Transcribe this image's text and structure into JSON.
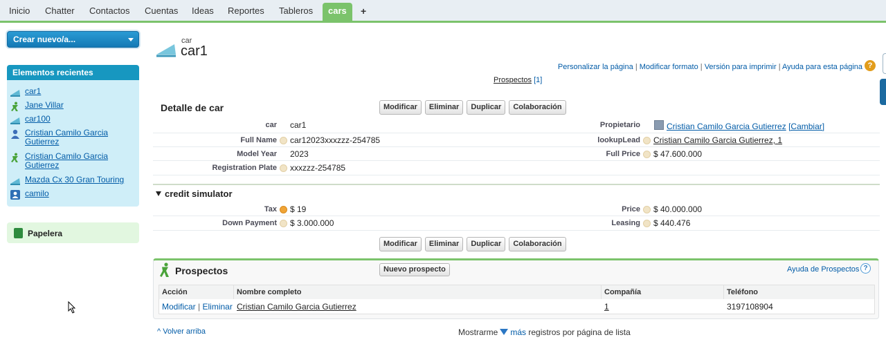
{
  "tabs": [
    {
      "label": "Inicio"
    },
    {
      "label": "Chatter"
    },
    {
      "label": "Contactos"
    },
    {
      "label": "Cuentas"
    },
    {
      "label": "Ideas"
    },
    {
      "label": "Reportes"
    },
    {
      "label": "Tableros"
    },
    {
      "label": "cars",
      "active": true
    }
  ],
  "tab_add": "+",
  "sidebar": {
    "create_new": "Crear nuevo/a...",
    "recent_title": "Elementos recientes",
    "recent_items": [
      {
        "label": "car1",
        "icon": "car-icon"
      },
      {
        "label": "Jane Villar",
        "icon": "lead-icon"
      },
      {
        "label": "car100",
        "icon": "car-icon"
      },
      {
        "label": "Cristian Camilo Garcia Gutierrez",
        "icon": "contact-icon"
      },
      {
        "label": "Cristian Camilo Garcia Gutierrez",
        "icon": "lead-icon"
      },
      {
        "label": "Mazda Cx 30 Gran Touring",
        "icon": "car-icon"
      },
      {
        "label": "camilo",
        "icon": "user-icon"
      }
    ],
    "trash": "Papelera"
  },
  "header": {
    "object_type": "car",
    "record_name": "car1",
    "links": [
      "Personalizar la página",
      "Modificar formato",
      "Versión para imprimir",
      "Ayuda para esta página"
    ],
    "related_link": "Prospectos",
    "related_count": "[1]"
  },
  "detail": {
    "title": "Detalle de car",
    "buttons": [
      "Modificar",
      "Eliminar",
      "Duplicar",
      "Colaboración"
    ],
    "fields": {
      "car_label": "car",
      "car_value": "car1",
      "owner_label": "Propietario",
      "owner_value": "Cristian Camilo Garcia Gutierrez",
      "owner_change": "[Cambiar]",
      "fullname_label": "Full Name",
      "fullname_value": "car12023xxxzzz-254785",
      "lookup_label": "lookupLead",
      "lookup_value": "Cristian Camilo Garcia Gutierrez, 1",
      "modelyear_label": "Model Year",
      "modelyear_value": "2023",
      "fullprice_label": "Full Price",
      "fullprice_value": "$ 47.600.000",
      "plate_label": "Registration Plate",
      "plate_value": "xxxzzz-254785"
    }
  },
  "credit": {
    "title": "credit simulator",
    "tax_label": "Tax",
    "tax_value": "$ 19",
    "price_label": "Price",
    "price_value": "$ 40.000.000",
    "down_label": "Down Payment",
    "down_value": "$ 3.000.000",
    "leasing_label": "Leasing",
    "leasing_value": "$ 440.476"
  },
  "related": {
    "title": "Prospectos",
    "new_button": "Nuevo prospecto",
    "help": "Ayuda de Prospectos",
    "columns": [
      "Acción",
      "Nombre completo",
      "Compañía",
      "Teléfono"
    ],
    "rows": [
      {
        "edit": "Modificar",
        "delete": "Eliminar",
        "name": "Cristian Camilo Garcia Gutierrez",
        "company": "1",
        "phone": "3197108904"
      }
    ]
  },
  "footer": {
    "back_top": "Volver arriba",
    "show_prefix": "Mostrarme",
    "show_more": "más",
    "show_suffix": "registros por página de lista"
  },
  "colors": {
    "accent": "#7bc36b",
    "link": "#015ba7",
    "recent_header": "#1797c0",
    "create_button": "#1e88c7"
  }
}
